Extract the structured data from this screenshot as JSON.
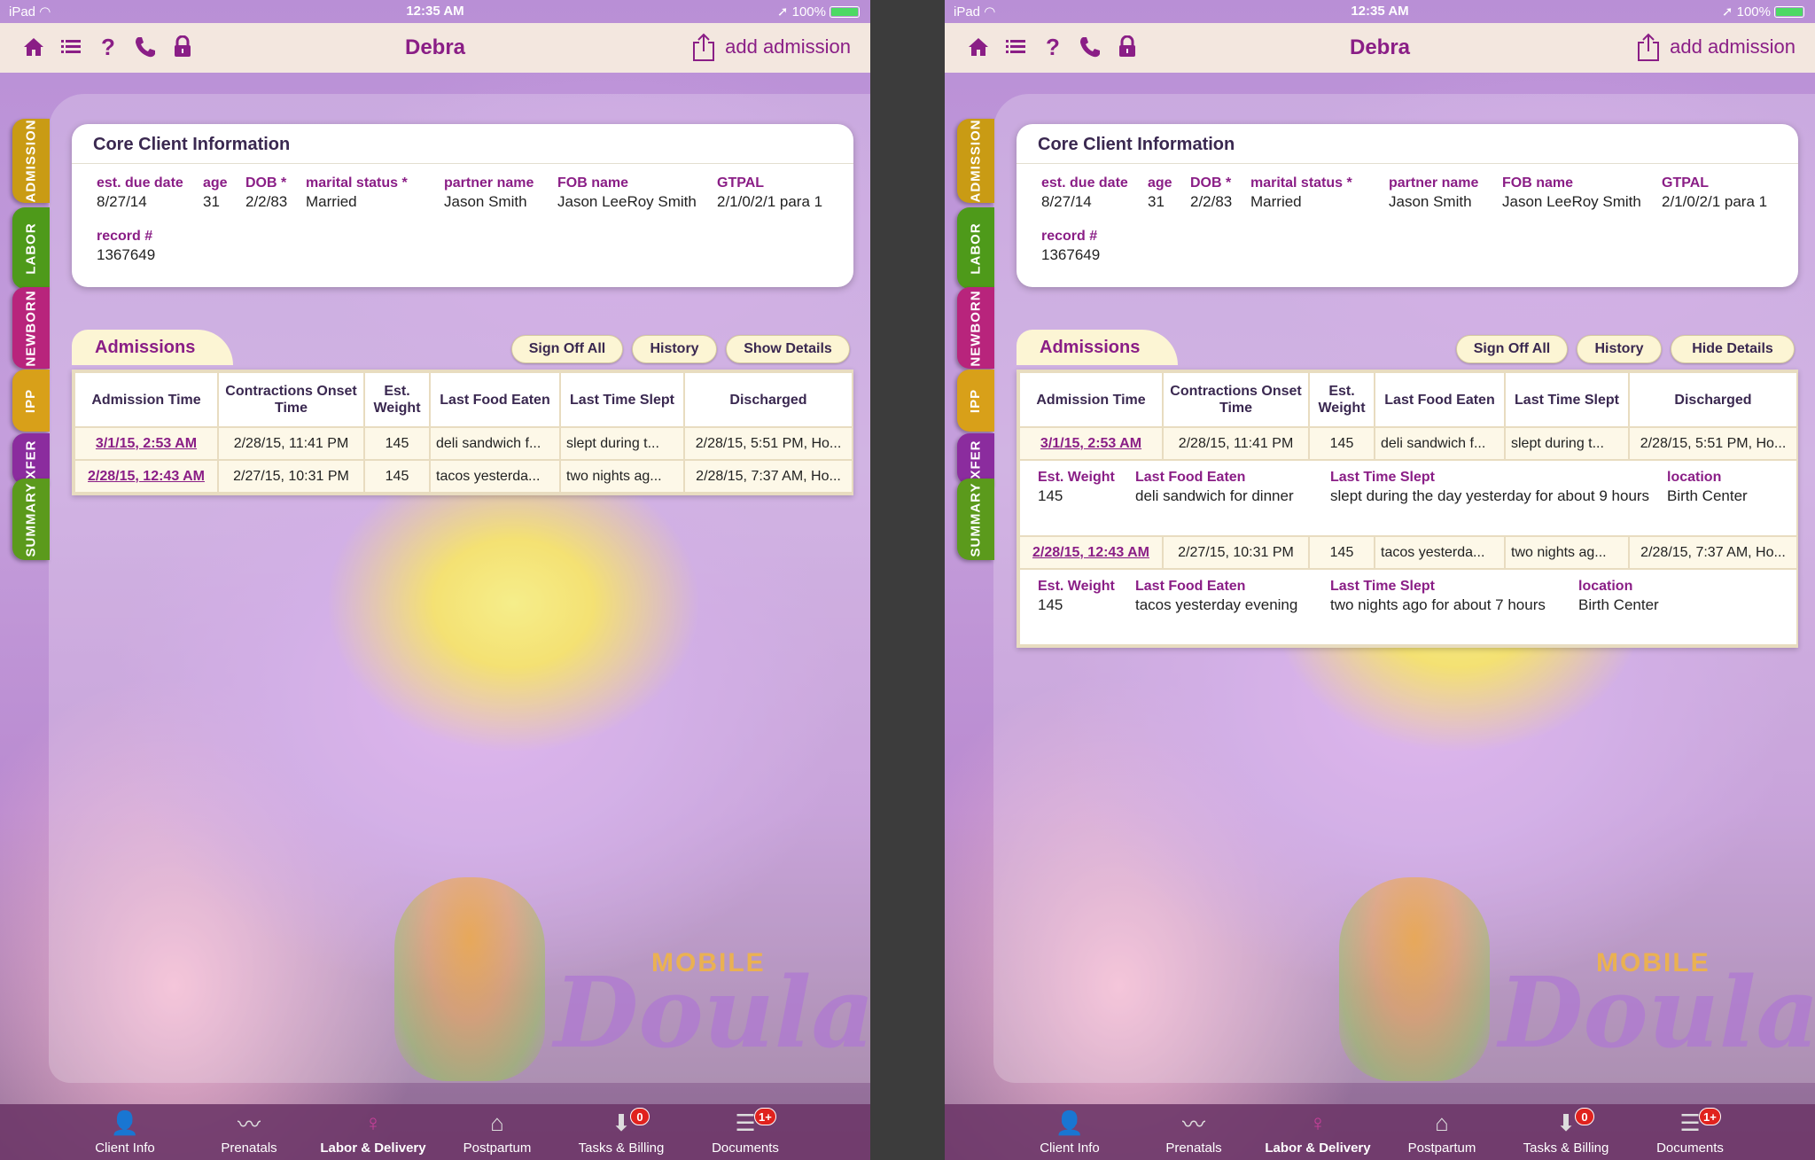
{
  "status_bar": {
    "device": "iPad",
    "time": "12:35 AM",
    "battery": "100%"
  },
  "nav": {
    "title": "Debra",
    "add_label": "add admission",
    "icons": [
      "home-icon",
      "list-icon",
      "help-icon",
      "phone-icon",
      "lock-icon"
    ]
  },
  "side_tabs": [
    {
      "label": "ADMISSION",
      "color": "#c99b14"
    },
    {
      "label": "LABOR",
      "color": "#4e9a1a"
    },
    {
      "label": "NEWBORN",
      "color": "#b8247c"
    },
    {
      "label": "IPP",
      "color": "#d8a019"
    },
    {
      "label": "XFER",
      "color": "#8b2c9e"
    },
    {
      "label": "SUMMARY",
      "color": "#5b9a1c"
    }
  ],
  "core": {
    "title": "Core Client Information",
    "fields": [
      {
        "label": "est. due date",
        "value": "8/27/14"
      },
      {
        "label": "age",
        "value": "31"
      },
      {
        "label": "DOB *",
        "value": "2/2/83"
      },
      {
        "label": "marital status *",
        "value": "Married"
      },
      {
        "label": "partner name",
        "value": "Jason Smith"
      },
      {
        "label": "FOB name",
        "value": "Jason LeeRoy Smith"
      },
      {
        "label": "GTPAL",
        "value": "2/1/0/2/1 para 1"
      },
      {
        "label": "record #",
        "value": "1367649"
      }
    ]
  },
  "admissions": {
    "title": "Admissions",
    "buttons": {
      "sign_off_all": "Sign Off All",
      "history": "History",
      "show_details": "Show Details",
      "hide_details": "Hide Details"
    },
    "columns": [
      "Admission Time",
      "Contractions Onset Time",
      "Est. Weight",
      "Last Food Eaten",
      "Last Time Slept",
      "Discharged"
    ],
    "rows": [
      [
        "3/1/15, 2:53 AM",
        "2/28/15, 11:41 PM",
        "145",
        "deli sandwich f...",
        "slept during t...",
        "2/28/15, 5:51 PM, Ho..."
      ],
      [
        "2/28/15, 12:43 AM",
        "2/27/15, 10:31 PM",
        "145",
        "tacos yesterda...",
        "two nights ag...",
        "2/28/15, 7:37 AM, Ho..."
      ]
    ],
    "details": [
      {
        "weight_label": "Est. Weight",
        "weight": "145",
        "food_label": "Last Food Eaten",
        "food": "deli sandwich for dinner",
        "slept_label": "Last Time Slept",
        "slept": "slept during the day yesterday for about 9 hours",
        "location_label": "location",
        "location": "Birth Center"
      },
      {
        "weight_label": "Est. Weight",
        "weight": "145",
        "food_label": "Last Food Eaten",
        "food": "tacos yesterday evening",
        "slept_label": "Last Time Slept",
        "slept": "two nights ago for about 7 hours",
        "location_label": "location",
        "location": "Birth Center"
      }
    ]
  },
  "logo": {
    "mobile": "MOBILE",
    "doula": "Doula"
  },
  "tab_bar": [
    {
      "label": "Client Info",
      "icon": "person-icon",
      "badge": ""
    },
    {
      "label": "Prenatals",
      "icon": "heartbeat-icon",
      "badge": ""
    },
    {
      "label": "Labor & Delivery",
      "icon": "pregnant-icon",
      "badge": "",
      "active": true
    },
    {
      "label": "Postpartum",
      "icon": "house-icon",
      "badge": ""
    },
    {
      "label": "Tasks & Billing",
      "icon": "inbox-icon",
      "badge": "0"
    },
    {
      "label": "Documents",
      "icon": "documents-icon",
      "badge": "1+"
    }
  ],
  "colors": {
    "accent": "#8a1e86",
    "card_tint": "#fcf5d4",
    "badge": "#e0221e"
  }
}
